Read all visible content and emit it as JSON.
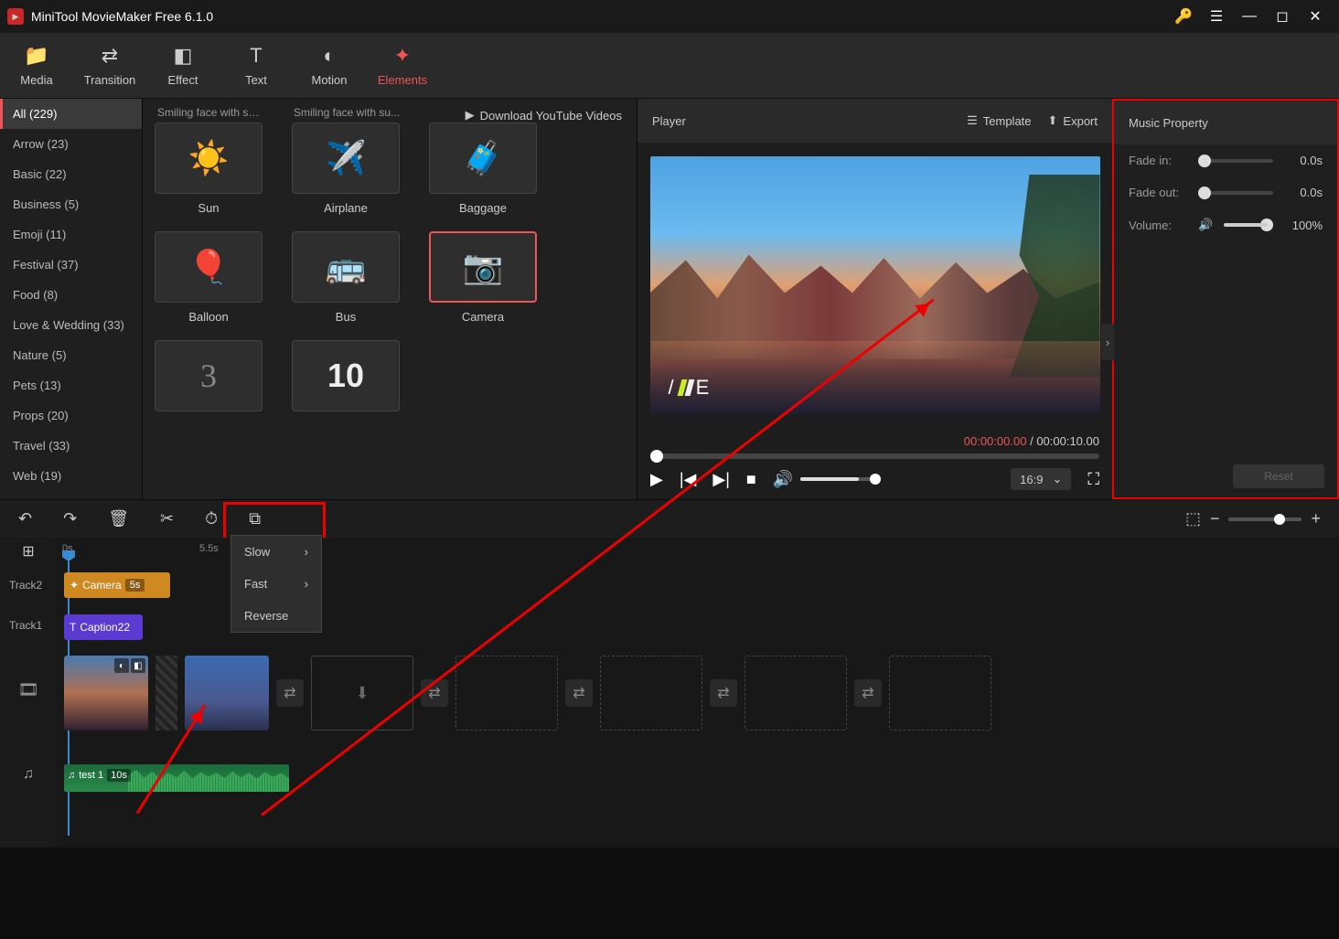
{
  "titlebar": {
    "title": "MiniTool MovieMaker Free 6.1.0"
  },
  "toptabs": {
    "media": "Media",
    "transition": "Transition",
    "effect": "Effect",
    "text": "Text",
    "motion": "Motion",
    "elements": "Elements"
  },
  "categories": [
    {
      "label": "All (229)",
      "active": true
    },
    {
      "label": "Arrow (23)"
    },
    {
      "label": "Basic (22)"
    },
    {
      "label": "Business (5)"
    },
    {
      "label": "Emoji (11)"
    },
    {
      "label": "Festival (37)"
    },
    {
      "label": "Food (8)"
    },
    {
      "label": "Love & Wedding (33)"
    },
    {
      "label": "Nature (5)"
    },
    {
      "label": "Pets (13)"
    },
    {
      "label": "Props (20)"
    },
    {
      "label": "Travel (33)"
    },
    {
      "label": "Web (19)"
    }
  ],
  "ytlink": "Download YouTube Videos",
  "elements_truncated": [
    "Smiling face with sm...",
    "Smiling face with su..."
  ],
  "elements": [
    {
      "name": "Sun",
      "emoji": "☀️"
    },
    {
      "name": "Airplane",
      "emoji": "✈️"
    },
    {
      "name": "Baggage",
      "emoji": "🧳"
    },
    {
      "name": "Balloon",
      "emoji": "🎈"
    },
    {
      "name": "Bus",
      "emoji": "🚌"
    },
    {
      "name": "Camera",
      "emoji": "📷",
      "selected": true
    },
    {
      "name": "",
      "emoji": "3"
    },
    {
      "name": "",
      "emoji": "10"
    }
  ],
  "player": {
    "title": "Player",
    "template": "Template",
    "export": "Export",
    "overlay_letter": "E",
    "cur_time": "00:00:00.00",
    "sep": "/",
    "total_time": "00:00:10.00",
    "ratio": "16:9"
  },
  "props": {
    "title": "Music Property",
    "fade_in_lbl": "Fade in:",
    "fade_in_val": "0.0s",
    "fade_out_lbl": "Fade out:",
    "fade_out_val": "0.0s",
    "volume_lbl": "Volume:",
    "volume_val": "100%",
    "reset": "Reset"
  },
  "speedmenu": {
    "slow": "Slow",
    "fast": "Fast",
    "reverse": "Reverse"
  },
  "timeline": {
    "ticks": {
      "t0": "0s",
      "t55": "5.5s"
    },
    "track2": "Track2",
    "track1": "Track1",
    "clip_cam_name": "Camera",
    "clip_cam_dur": "5s",
    "clip_cap_name": "Caption22",
    "audio_name": "test 1",
    "audio_dur": "10s"
  }
}
